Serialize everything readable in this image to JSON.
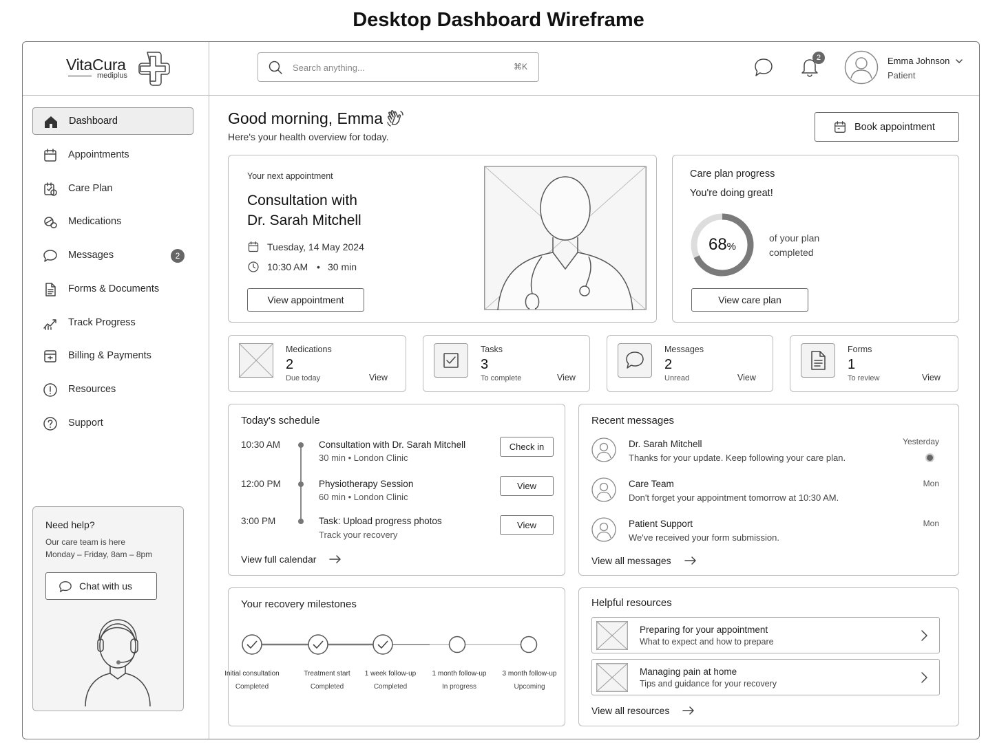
{
  "page_title": "Desktop Dashboard Wireframe",
  "brand": {
    "name": "VitaCura",
    "sub": "mediplus"
  },
  "sidebar": {
    "items": [
      {
        "label": "Dashboard",
        "icon": "home-icon",
        "active": true
      },
      {
        "label": "Appointments",
        "icon": "calendar-icon"
      },
      {
        "label": "Care Plan",
        "icon": "care-plan-icon"
      },
      {
        "label": "Medications",
        "icon": "pill-icon"
      },
      {
        "label": "Messages",
        "icon": "chat-icon",
        "badge": "2"
      },
      {
        "label": "Forms & Documents",
        "icon": "document-icon"
      },
      {
        "label": "Track Progress",
        "icon": "trend-icon"
      },
      {
        "label": "Billing & Payments",
        "icon": "billing-icon"
      },
      {
        "label": "Resources",
        "icon": "info-icon"
      },
      {
        "label": "Support",
        "icon": "help-icon"
      }
    ],
    "help": {
      "title": "Need help?",
      "line1": "Our care team is here",
      "line2": "Monday – Friday, 8am – 8pm",
      "button": "Chat with us"
    }
  },
  "topbar": {
    "search_placeholder": "Search anything...",
    "search_shortcut": "⌘K",
    "notification_count": "2",
    "user_name": "Emma Johnson",
    "user_role": "Patient"
  },
  "greeting": {
    "title": "Good morning, Emma",
    "subtitle": "Here's your health overview for today.",
    "book_button": "Book appointment"
  },
  "next_appointment": {
    "label": "Your next appointment",
    "title_line1": "Consultation with",
    "title_line2": "Dr. Sarah Mitchell",
    "date": "Tuesday, 14 May 2024",
    "time": "10:30 AM",
    "separator": "•",
    "duration": "30 min",
    "button": "View appointment"
  },
  "care_plan": {
    "title": "Care plan progress",
    "subtitle": "You're doing great!",
    "percent": 68,
    "percent_text": "68",
    "percent_sign": "%",
    "desc_line1": "of your plan",
    "desc_line2": "completed",
    "button": "View care plan"
  },
  "stats": [
    {
      "label": "Medications",
      "value": "2",
      "sub": "Due today",
      "link": "View",
      "icon": "image-placeholder-icon"
    },
    {
      "label": "Tasks",
      "value": "3",
      "sub": "To complete",
      "link": "View",
      "icon": "checkbox-icon"
    },
    {
      "label": "Messages",
      "value": "2",
      "sub": "Unread",
      "link": "View",
      "icon": "chat-bubble-icon"
    },
    {
      "label": "Forms",
      "value": "1",
      "sub": "To review",
      "link": "View",
      "icon": "document-icon"
    }
  ],
  "schedule": {
    "title": "Today's schedule",
    "items": [
      {
        "time": "10:30 AM",
        "title": "Consultation with Dr. Sarah Mitchell",
        "meta": "30 min  •  London Clinic",
        "button": "Check in"
      },
      {
        "time": "12:00 PM",
        "title": "Physiotherapy Session",
        "meta": "60 min  •  London Clinic",
        "button": "View"
      },
      {
        "time": "3:00 PM",
        "title": "Task: Upload progress photos",
        "meta": "Track your recovery",
        "button": "View"
      }
    ],
    "link": "View full calendar"
  },
  "messages": {
    "title": "Recent messages",
    "items": [
      {
        "name": "Dr. Sarah Mitchell",
        "text": "Thanks for your update. Keep following your care plan.",
        "time": "Yesterday",
        "unread": true
      },
      {
        "name": "Care Team",
        "text": "Don't forget your appointment tomorrow at 10:30 AM.",
        "time": "Mon"
      },
      {
        "name": "Patient Support",
        "text": "We've received your form submission.",
        "time": "Mon"
      }
    ],
    "link": "View all messages"
  },
  "milestones": {
    "title": "Your recovery milestones",
    "items": [
      {
        "name": "Initial consultation",
        "status": "Completed",
        "done": true
      },
      {
        "name": "Treatment start",
        "status": "Completed",
        "done": true
      },
      {
        "name": "1 week follow-up",
        "status": "Completed",
        "done": true
      },
      {
        "name": "1 month follow-up",
        "status": "In progress",
        "done": false
      },
      {
        "name": "3 month follow-up",
        "status": "Upcoming",
        "done": false
      }
    ]
  },
  "resources": {
    "title": "Helpful resources",
    "items": [
      {
        "title": "Preparing for your appointment",
        "sub": "What to expect and how to prepare"
      },
      {
        "title": "Managing pain at home",
        "sub": "Tips and guidance for your recovery"
      }
    ],
    "link": "View all resources"
  },
  "colors": {
    "border": "#bbbbbb",
    "badge": "#666666",
    "active_bg": "#eeeeee",
    "text": "#222222"
  }
}
